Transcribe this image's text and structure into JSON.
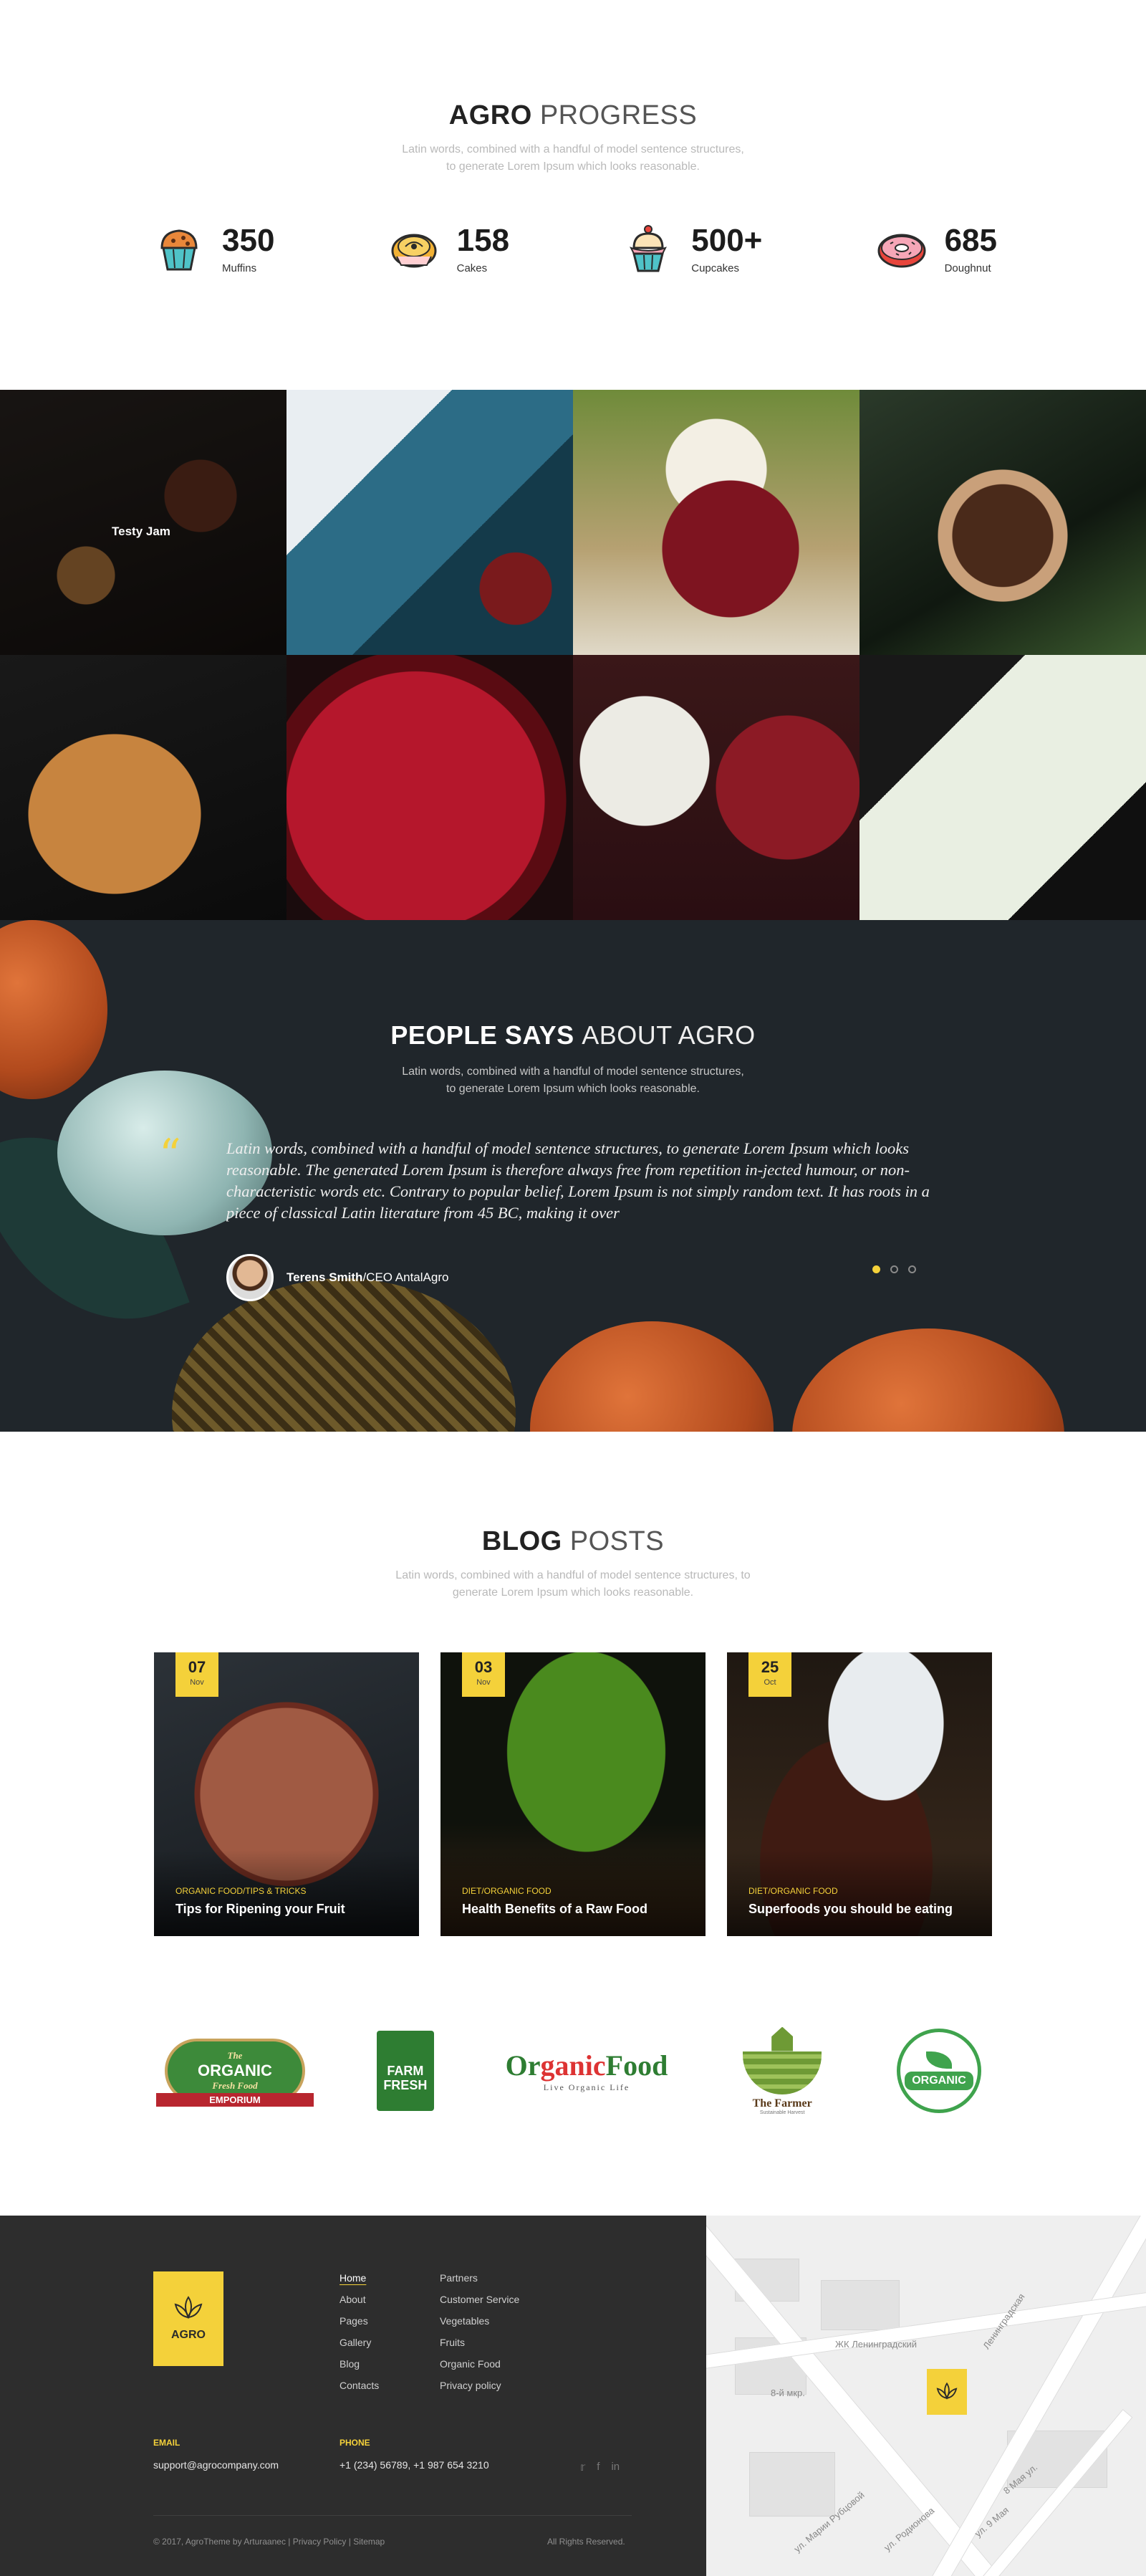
{
  "progress": {
    "title_bold": "AGRO",
    "title_light": "PROGRESS",
    "subtitle_line1": "Latin words, combined with a handful of model sentence structures,",
    "subtitle_line2": "to generate Lorem Ipsum which looks reasonable.",
    "stats": [
      {
        "icon": "muffin-icon",
        "value": "350",
        "label": "Muffins"
      },
      {
        "icon": "cake-icon",
        "value": "158",
        "label": "Cakes"
      },
      {
        "icon": "cupcake-icon",
        "value": "500+",
        "label": "Cupcakes"
      },
      {
        "icon": "doughnut-icon",
        "value": "685",
        "label": "Doughnut"
      }
    ]
  },
  "gallery": {
    "first_caption": "Testy Jam"
  },
  "testimonials": {
    "title_bold": "PEOPLE SAYS",
    "title_light": "ABOUT AGRO",
    "subtitle_line1": "Latin words, combined with a handful of model sentence structures,",
    "subtitle_line2": "to generate Lorem Ipsum which looks reasonable.",
    "quote": "Latin words, combined with a handful of model sentence structures, to generate Lorem Ipsum which looks reasonable. The generated Lorem Ipsum is therefore always free from repetition in-jected humour, or non-characteristic words etc.  Contrary to popular belief, Lorem Ipsum is not simply random text. It has roots in a piece of classical Latin literature from 45 BC, making it over",
    "author_name": "Terens Smith",
    "author_role": "/CEO AntalAgro",
    "active_slide": 1,
    "slide_count": 3
  },
  "blog": {
    "title_bold": "BLOG",
    "title_light": "POSTS",
    "subtitle_line1": "Latin words, combined with a handful of model sentence structures, to",
    "subtitle_line2": "generate Lorem Ipsum which looks reasonable.",
    "posts": [
      {
        "day": "07",
        "month": "Nov",
        "category": "Organic Food/Tips & Tricks",
        "title": "Tips for Ripening your Fruit"
      },
      {
        "day": "03",
        "month": "Nov",
        "category": "Diet/Organic Food",
        "title": "Health Benefits of a Raw Food"
      },
      {
        "day": "25",
        "month": "Oct",
        "category": "Diet/Organic Food",
        "title": "Superfoods you should be eating"
      }
    ]
  },
  "partners": {
    "l1_top": "ORGANIC",
    "l1_mid": "Fresh Food",
    "l1_bottom": "EMPORIUM",
    "l2_text1": "FARM",
    "l2_text2": "FRESH",
    "l3_a": "Or",
    "l3_b": "ganic",
    "l3_c": "Food",
    "l3_tag": "Live Organic Life",
    "l4_name": "The Farmer",
    "l4_sub": "Sustainable Harvest",
    "l5_text": "ORGANIC"
  },
  "footer": {
    "brand": "AGRO",
    "nav_col1": [
      "Home",
      "About",
      "Pages",
      "Gallery",
      "Blog",
      "Contacts"
    ],
    "nav_col2": [
      "Partners",
      "Customer Service",
      "Vegetables",
      "Fruits",
      "Organic Food",
      "Privacy policy"
    ],
    "email_label": "Email",
    "email": "support@agrocompany.com",
    "phone_label": "Phone",
    "phone": "+1 (234) 56789,  +1 987 654 3210",
    "copyright": "© 2017, AgroTheme by Arturaanec | Privacy Policy | Sitemap",
    "rights": "All Rights Reserved."
  },
  "map": {
    "label1": "ЖК Ленинградский",
    "label2": "Ленинградская",
    "label3": "8-й мкр.",
    "label4": "ул. Марии Рубцовой",
    "label5": "ул. Родионова",
    "label6": "ул. 9 Мая",
    "label7": "8 Мая ул."
  },
  "colors": {
    "accent": "#f4d13a",
    "footer_bg": "#2d2d2d",
    "testimonials_bg": "#20262b"
  }
}
